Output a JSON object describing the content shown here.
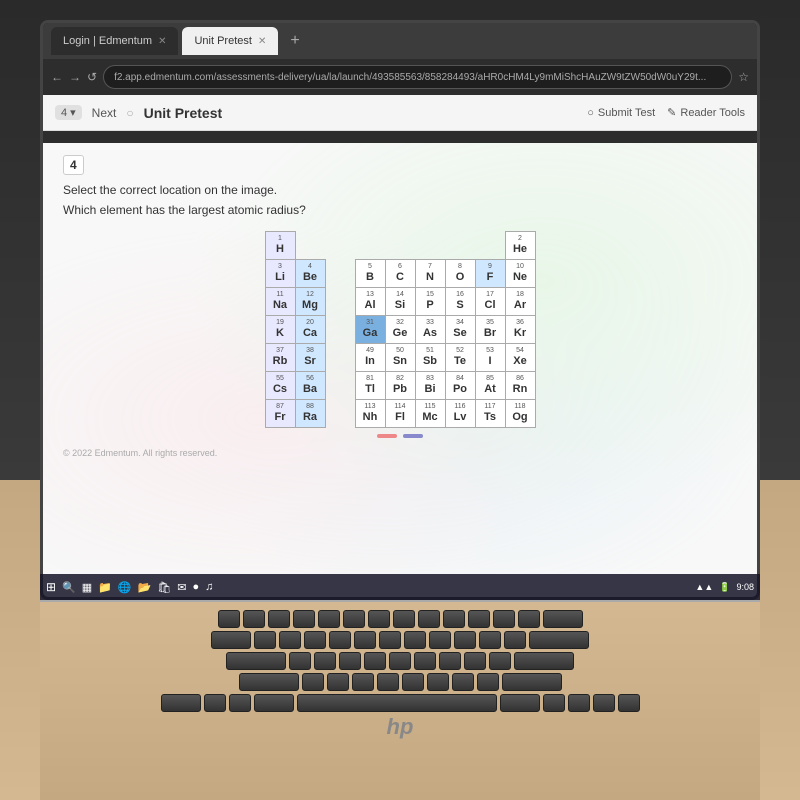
{
  "browser": {
    "tabs": [
      {
        "label": "Login | Edmentum",
        "active": false
      },
      {
        "label": "Unit Pretest",
        "active": true
      }
    ],
    "address": "f2.app.edmentum.com/assessments-delivery/ua/la/launch/493585563/858284493/aHR0cHM4Ly9mMiShcHAuZW9tZW50dW0uY29t...",
    "tab_add": "+",
    "nav": {
      "back_count": "4",
      "next_label": "Next",
      "title": "Unit Pretest",
      "submit_label": "Submit Test",
      "reader_label": "Reader Tools"
    }
  },
  "question": {
    "number": "4",
    "instruction": "Select the correct location on the image.",
    "text": "Which element has the largest atomic radius?"
  },
  "periodic_table": {
    "elements": [
      {
        "num": 1,
        "symbol": "H",
        "row": 1,
        "col": 1
      },
      {
        "num": 2,
        "symbol": "He",
        "row": 1,
        "col": 18
      },
      {
        "num": 3,
        "symbol": "Li",
        "row": 2,
        "col": 1
      },
      {
        "num": 4,
        "symbol": "Be",
        "row": 2,
        "col": 2
      },
      {
        "num": 5,
        "symbol": "B",
        "row": 2,
        "col": 13
      },
      {
        "num": 6,
        "symbol": "C",
        "row": 2,
        "col": 14
      },
      {
        "num": 7,
        "symbol": "N",
        "row": 2,
        "col": 15
      },
      {
        "num": 8,
        "symbol": "O",
        "row": 2,
        "col": 16
      },
      {
        "num": 9,
        "symbol": "F",
        "row": 2,
        "col": 17
      },
      {
        "num": 10,
        "symbol": "Ne",
        "row": 2,
        "col": 18
      },
      {
        "num": 11,
        "symbol": "Na",
        "row": 3,
        "col": 1
      },
      {
        "num": 12,
        "symbol": "Mg",
        "row": 3,
        "col": 2
      },
      {
        "num": 13,
        "symbol": "Al",
        "row": 3,
        "col": 13
      },
      {
        "num": 14,
        "symbol": "Si",
        "row": 3,
        "col": 14
      },
      {
        "num": 15,
        "symbol": "P",
        "row": 3,
        "col": 15
      },
      {
        "num": 16,
        "symbol": "S",
        "row": 3,
        "col": 16
      },
      {
        "num": 17,
        "symbol": "Cl",
        "row": 3,
        "col": 17
      },
      {
        "num": 18,
        "symbol": "Ar",
        "row": 3,
        "col": 18
      },
      {
        "num": 19,
        "symbol": "K",
        "row": 4,
        "col": 1
      },
      {
        "num": 20,
        "symbol": "Ca",
        "row": 4,
        "col": 2
      },
      {
        "num": 31,
        "symbol": "Ga",
        "row": 4,
        "col": 13
      },
      {
        "num": 32,
        "symbol": "Ge",
        "row": 4,
        "col": 14
      },
      {
        "num": 33,
        "symbol": "As",
        "row": 4,
        "col": 15
      },
      {
        "num": 34,
        "symbol": "Se",
        "row": 4,
        "col": 16
      },
      {
        "num": 35,
        "symbol": "Br",
        "row": 4,
        "col": 17
      },
      {
        "num": 36,
        "symbol": "Kr",
        "row": 4,
        "col": 18
      },
      {
        "num": 37,
        "symbol": "Rb",
        "row": 5,
        "col": 1
      },
      {
        "num": 38,
        "symbol": "Sr",
        "row": 5,
        "col": 2
      },
      {
        "num": 49,
        "symbol": "In",
        "row": 5,
        "col": 13
      },
      {
        "num": 50,
        "symbol": "Sn",
        "row": 5,
        "col": 14
      },
      {
        "num": 51,
        "symbol": "Sb",
        "row": 5,
        "col": 15
      },
      {
        "num": 52,
        "symbol": "Te",
        "row": 5,
        "col": 16
      },
      {
        "num": 53,
        "symbol": "I",
        "row": 5,
        "col": 17
      },
      {
        "num": 54,
        "symbol": "Xe",
        "row": 5,
        "col": 18
      },
      {
        "num": 55,
        "symbol": "Cs",
        "row": 6,
        "col": 1
      },
      {
        "num": 56,
        "symbol": "Ba",
        "row": 6,
        "col": 2
      },
      {
        "num": 81,
        "symbol": "Tl",
        "row": 6,
        "col": 13
      },
      {
        "num": 82,
        "symbol": "Pb",
        "row": 6,
        "col": 14
      },
      {
        "num": 83,
        "symbol": "Bi",
        "row": 6,
        "col": 15
      },
      {
        "num": 84,
        "symbol": "Po",
        "row": 6,
        "col": 16
      },
      {
        "num": 85,
        "symbol": "At",
        "row": 6,
        "col": 17
      },
      {
        "num": 86,
        "symbol": "Rn",
        "row": 6,
        "col": 18
      },
      {
        "num": 87,
        "symbol": "Fr",
        "row": 7,
        "col": 1
      },
      {
        "num": 88,
        "symbol": "Ra",
        "row": 7,
        "col": 2
      },
      {
        "num": 113,
        "symbol": "Nh",
        "row": 7,
        "col": 13
      },
      {
        "num": 114,
        "symbol": "Fl",
        "row": 7,
        "col": 14
      },
      {
        "num": 115,
        "symbol": "Mc",
        "row": 7,
        "col": 15
      },
      {
        "num": 116,
        "symbol": "Lv",
        "row": 7,
        "col": 16
      },
      {
        "num": 117,
        "symbol": "Ts",
        "row": 7,
        "col": 17
      },
      {
        "num": 118,
        "symbol": "Og",
        "row": 7,
        "col": 18
      }
    ]
  },
  "footer": {
    "copyright": "© 2022 Edmentum. All rights reserved."
  },
  "taskbar": {
    "time": "9:08",
    "icons": [
      "⊞",
      "🔍",
      "💬",
      "📁",
      "🌐",
      "📂",
      "🖥",
      "✉",
      "🎵"
    ]
  }
}
